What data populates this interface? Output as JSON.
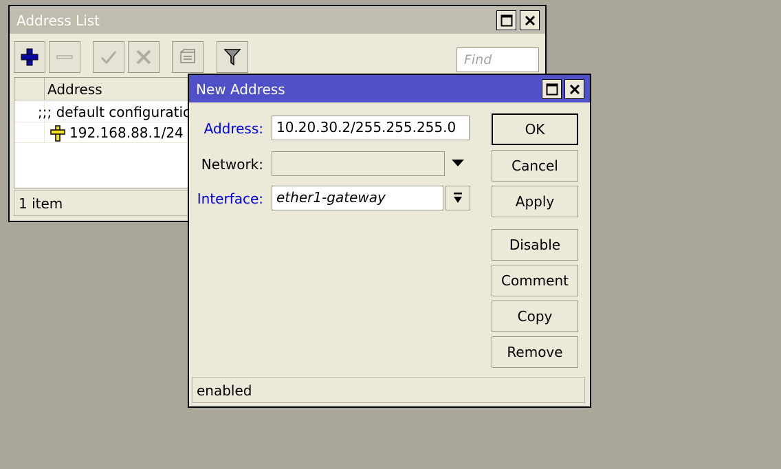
{
  "address_list": {
    "title": "Address List",
    "find_placeholder": "Find",
    "column_header": "Address",
    "rows": [
      {
        "text": ";;; default configuration"
      },
      {
        "text": "192.168.88.1/24"
      }
    ],
    "status": "1 item"
  },
  "new_address": {
    "title": "New Address",
    "address_label": "Address:",
    "address_value": "10.20.30.2/255.255.255.0",
    "network_label": "Network:",
    "network_value": "",
    "interface_label": "Interface:",
    "interface_value": "ether1-gateway",
    "buttons": {
      "ok": "OK",
      "cancel": "Cancel",
      "apply": "Apply",
      "disable": "Disable",
      "comment": "Comment",
      "copy": "Copy",
      "remove": "Remove"
    },
    "status": "enabled"
  },
  "colors": {
    "desktop": "#aaa79a",
    "inactive_title": "#c0bdaf",
    "active_title": "#5050c8",
    "label_blue": "#0000e0"
  }
}
